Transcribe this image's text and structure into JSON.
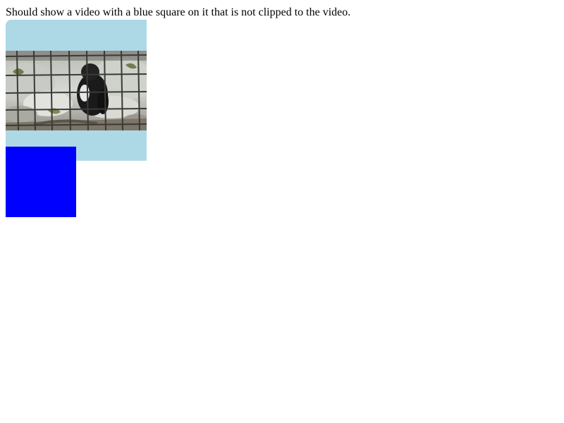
{
  "caption": "Should show a video with a blue square on it that is not clipped to the video.",
  "video": {
    "background_color": "#add8e6"
  },
  "overlay_square": {
    "color": "#0000ff"
  }
}
